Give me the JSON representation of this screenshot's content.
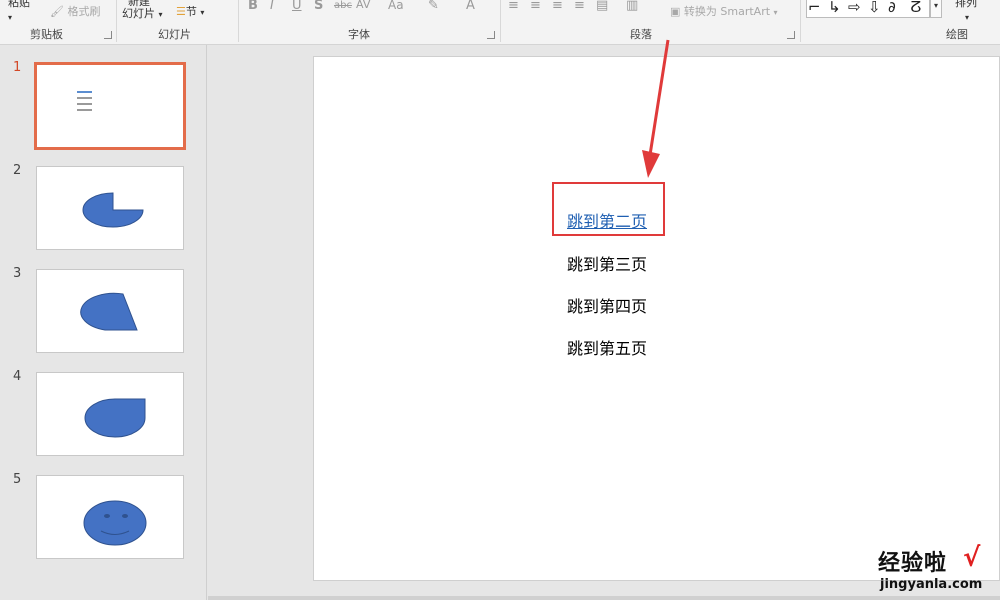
{
  "ribbon": {
    "clipboard": {
      "paste_label": "粘贴",
      "format_painter_label": "格式刷",
      "group_label": "剪贴板"
    },
    "slides": {
      "new_slide_top": "新建",
      "new_slide_label": "幻灯片",
      "section_label": "节",
      "group_label": "幻灯片"
    },
    "font": {
      "bold": "B",
      "italic": "I",
      "underline": "U",
      "shadow": "S",
      "strike": "abc",
      "spacing": "AV",
      "case": "Aa",
      "color": "A",
      "group_label": "字体"
    },
    "paragraph": {
      "smartart_label": "转换为 SmartArt",
      "group_label": "段落"
    },
    "drawing": {
      "arrange_label": "排列",
      "group_label": "绘图"
    }
  },
  "thumbnails": [
    {
      "number": "1",
      "shape": "text-links",
      "active": true
    },
    {
      "number": "2",
      "shape": "pie-shape",
      "active": false
    },
    {
      "number": "3",
      "shape": "chord-shape",
      "active": false
    },
    {
      "number": "4",
      "shape": "teardrop-shape",
      "active": false
    },
    {
      "number": "5",
      "shape": "smiley-shape",
      "active": false
    }
  ],
  "slide": {
    "links": [
      {
        "text": "跳到第二页",
        "hyperlink": true
      },
      {
        "text": "跳到第三页",
        "hyperlink": false
      },
      {
        "text": "跳到第四页",
        "hyperlink": false
      },
      {
        "text": "跳到第五页",
        "hyperlink": false
      }
    ]
  },
  "watermark": {
    "brand": "经验啦",
    "check": "√",
    "url": "jingyanla.com"
  },
  "colors": {
    "accent_active_thumb": "#e36c4a",
    "highlight_box": "#e03a3a",
    "hyperlink": "#1f5fb2",
    "shape_fill": "#4472c4",
    "shape_stroke": "#2f528f"
  }
}
